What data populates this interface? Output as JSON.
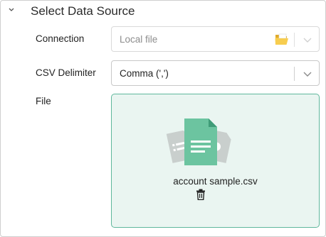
{
  "section": {
    "title": "Select Data Source",
    "chevron_icon": "chevron-down-icon"
  },
  "connection": {
    "label": "Connection",
    "value": "Local file",
    "folder_icon": "folder-open-icon",
    "chevron_icon": "chevron-down-icon"
  },
  "delimiter": {
    "label": "CSV Delimiter",
    "value": "Comma (',')",
    "chevron_icon": "chevron-down-icon"
  },
  "file": {
    "label": "File",
    "illustration_icon": "file-documents-icon",
    "file_name": "account sample.csv",
    "delete_icon": "trash-icon"
  },
  "colors": {
    "accent": "#5fb79c",
    "dropzone_bg": "#eaf5f1",
    "file_icon": "#6cc4a0",
    "folder": "#f4c542"
  }
}
